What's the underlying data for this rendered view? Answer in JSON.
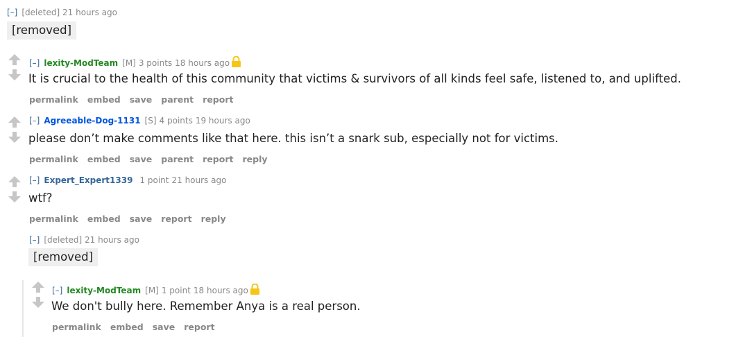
{
  "comments": [
    {
      "toggle": "[–]",
      "author": "[deleted]",
      "time": "21 hours ago",
      "body": "[removed]"
    },
    {
      "toggle": "[–]",
      "author": "lexity-ModTeam",
      "flair": "[M]",
      "score": "3 points",
      "time": "18 hours ago",
      "body": "It is crucial to the health of this community that victims & survivors of all kinds feel safe, listened to, and uplifted.",
      "buttons": [
        "permalink",
        "embed",
        "save",
        "parent",
        "report"
      ],
      "locked_icon": "lock-icon"
    },
    {
      "toggle": "[–]",
      "author": "Agreeable-Dog-1131",
      "flair": "[S]",
      "score": "4 points",
      "time": "19 hours ago",
      "body": "please don’t make comments like that here. this isn’t a snark sub, especially not for victims.",
      "buttons": [
        "permalink",
        "embed",
        "save",
        "parent",
        "report",
        "reply"
      ]
    },
    {
      "toggle": "[–]",
      "author": "Expert_Expert1339",
      "score": "1 point",
      "time": "21 hours ago",
      "body": "wtf?",
      "buttons": [
        "permalink",
        "embed",
        "save",
        "report",
        "reply"
      ]
    },
    {
      "toggle": "[–]",
      "author": "[deleted]",
      "time": "21 hours ago",
      "body": "[removed]"
    },
    {
      "toggle": "[–]",
      "author": "lexity-ModTeam",
      "flair": "[M]",
      "score": "1 point",
      "time": "18 hours ago",
      "body": "We don't bully here. Remember Anya is a real person.",
      "buttons": [
        "permalink",
        "embed",
        "save",
        "report"
      ],
      "locked_icon": "lock-icon"
    }
  ],
  "colors": {
    "mod_author": "#228822",
    "submitter_author": "#0055df",
    "author": "#336699",
    "meta": "#888888",
    "lock": "#f5c518"
  }
}
